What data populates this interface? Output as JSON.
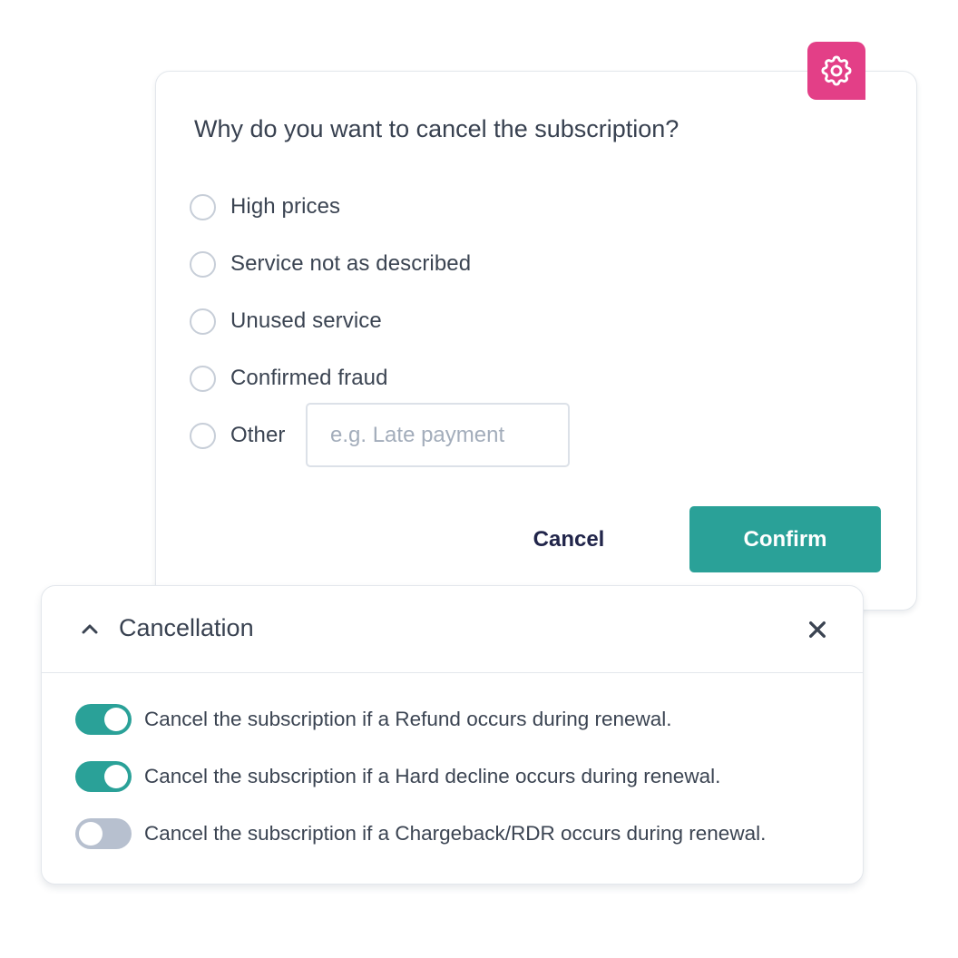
{
  "reason_dialog": {
    "title": "Why do you want to cancel the subscription?",
    "options": [
      {
        "label": "High prices",
        "selected": false
      },
      {
        "label": "Service not as described",
        "selected": false
      },
      {
        "label": "Unused service",
        "selected": false
      },
      {
        "label": "Confirmed fraud",
        "selected": false
      },
      {
        "label": "Other",
        "selected": false
      }
    ],
    "other_input": {
      "value": "",
      "placeholder": "e.g. Late payment"
    },
    "cancel_label": "Cancel",
    "confirm_label": "Confirm",
    "badge_icon": "gear-icon"
  },
  "cancellation_panel": {
    "title": "Cancellation",
    "collapse_icon": "chevron-up-icon",
    "close_icon": "close-icon",
    "rules": [
      {
        "label": "Cancel the subscription if a Refund occurs during renewal.",
        "enabled": true
      },
      {
        "label": "Cancel the subscription if a Hard decline occurs during renewal.",
        "enabled": true
      },
      {
        "label": "Cancel the subscription if a Chargeback/RDR occurs during renewal.",
        "enabled": false
      }
    ]
  },
  "colors": {
    "accent": "#2aa198",
    "badge": "#e33f87",
    "toggle_off": "#b7c0cf",
    "text": "#3b4452",
    "cancel_text": "#21254a"
  }
}
